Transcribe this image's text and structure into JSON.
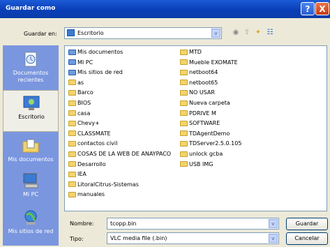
{
  "window": {
    "title": "Guardar como",
    "help": "?",
    "close": "X"
  },
  "toolbar": {
    "save_in_label": "Guardar en:",
    "save_in_value": "Escritorio",
    "dropdown_glyph": "v",
    "tools": [
      {
        "name": "back-icon",
        "glyph": "◉"
      },
      {
        "name": "up-folder-icon",
        "glyph": "⇧"
      },
      {
        "name": "new-folder-icon",
        "glyph": "✦"
      },
      {
        "name": "views-menu-icon",
        "glyph": "☷"
      }
    ]
  },
  "places": [
    {
      "label": "Documentos recientes",
      "icon": "recent-documents-icon"
    },
    {
      "label": "Escritorio",
      "icon": "desktop-icon",
      "active": true
    },
    {
      "label": "Mis documentos",
      "icon": "my-documents-icon"
    },
    {
      "label": "Mi PC",
      "icon": "my-computer-icon"
    },
    {
      "label": "Mis sitios de red",
      "icon": "network-places-icon"
    }
  ],
  "files": {
    "column1": [
      {
        "name": "Mis documentos",
        "icon": "special"
      },
      {
        "name": "MI PC",
        "icon": "special"
      },
      {
        "name": "Mis sitios de red",
        "icon": "special"
      },
      {
        "name": "as",
        "icon": "folder"
      },
      {
        "name": "Barco",
        "icon": "folder"
      },
      {
        "name": "BIOS",
        "icon": "folder"
      },
      {
        "name": "casa",
        "icon": "folder"
      },
      {
        "name": "Chevy+",
        "icon": "folder"
      },
      {
        "name": "CLASSMATE",
        "icon": "folder"
      },
      {
        "name": "contactos civil",
        "icon": "folder"
      },
      {
        "name": "COSAS DE LA WEB DE ANAYPACO",
        "icon": "folder"
      },
      {
        "name": "Desarrollo",
        "icon": "folder"
      },
      {
        "name": "IEA",
        "icon": "folder"
      },
      {
        "name": "LitoralCitrus-Sistemas",
        "icon": "folder"
      },
      {
        "name": "manuales",
        "icon": "folder"
      }
    ],
    "column2": [
      {
        "name": "MTD",
        "icon": "folder"
      },
      {
        "name": "Mueble EXOMATE",
        "icon": "folder"
      },
      {
        "name": "netboot64",
        "icon": "folder"
      },
      {
        "name": "netboot65",
        "icon": "folder"
      },
      {
        "name": "NO USAR",
        "icon": "folder"
      },
      {
        "name": "Nueva carpeta",
        "icon": "folder"
      },
      {
        "name": "PDRIVE M",
        "icon": "folder"
      },
      {
        "name": "SOFTWARE",
        "icon": "folder"
      },
      {
        "name": "TDAgentDemo",
        "icon": "folder"
      },
      {
        "name": "TDServer2.5.0.105",
        "icon": "folder"
      },
      {
        "name": "unlock gcba",
        "icon": "folder"
      },
      {
        "name": "USB IMG",
        "icon": "folder"
      }
    ]
  },
  "form": {
    "name_label": "Nombre:",
    "name_value": "tcopp.bin",
    "type_label": "Tipo:",
    "type_value": "VLC media file (.bin)",
    "save_button": "Guardar",
    "cancel_button": "Cancelar"
  }
}
